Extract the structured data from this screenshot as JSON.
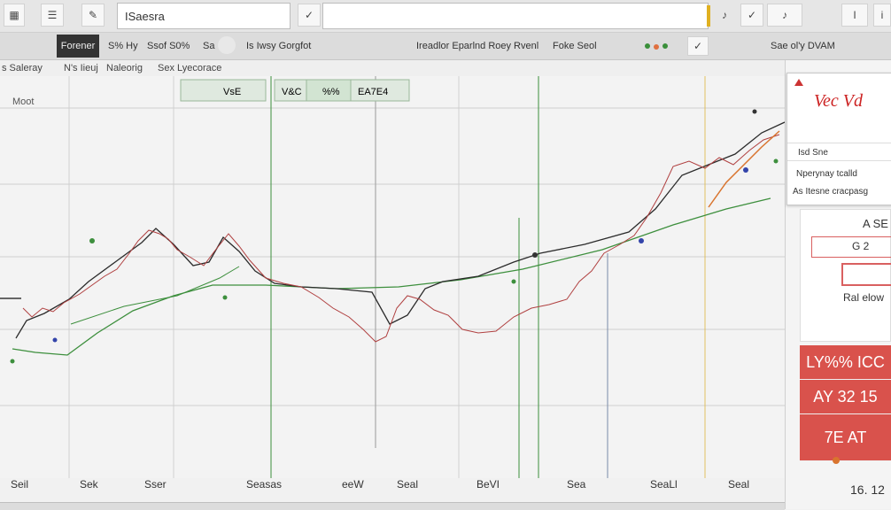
{
  "toolbar": {
    "search_value": "ISaesra",
    "check_icon": "✓",
    "lock_icon": "🔒",
    "field2_value": "",
    "right_mark1": "♪",
    "right_mark2": "✓",
    "right_mark3": "♪",
    "right_end": "I",
    "right_end2": "i"
  },
  "bar2": {
    "active_button": "Forener",
    "item1": "S% Hy",
    "item2": "Ssof S0%",
    "item3": "Sa",
    "title": "Is Iwsy Gorgfot",
    "center": "Ireadlor Eparlnd Roey Rvenl",
    "center2": "Foke Seol",
    "right": "Sae ol'y  DVAM"
  },
  "tabs": [
    "s Saleray",
    "N's Iieuj",
    "Naleorig",
    "Sex Lyecorace"
  ],
  "chart": {
    "ylabel": "Moot",
    "badges": [
      "VsE",
      "V&C",
      "%%",
      "EA7E4"
    ],
    "x_labels": [
      "Seil",
      "Sek",
      "Sser",
      "Seasas",
      "eeW",
      "Seal",
      "BeVI",
      "Sea",
      "SeaLl",
      "Seal"
    ]
  },
  "panel": {
    "logo_text": "Vec Vd",
    "popup_title": "Isd Sne",
    "popup_line1": "Nperynay tcalld",
    "popup_line2": "As Itesne cracpasg",
    "label1": "A SE",
    "label2": "G 2",
    "label3": "Ral elow",
    "red1": "LY%% ICC",
    "red2": "AY 32 15",
    "red3": "7E AT",
    "bottom": "16. 12"
  },
  "colors": {
    "black_line": "#2b2b2b",
    "red_line": "#cc3333",
    "green_line": "#3d8f3d",
    "accent_red": "#d9524c",
    "panel_bg": "#f4f4f4"
  }
}
